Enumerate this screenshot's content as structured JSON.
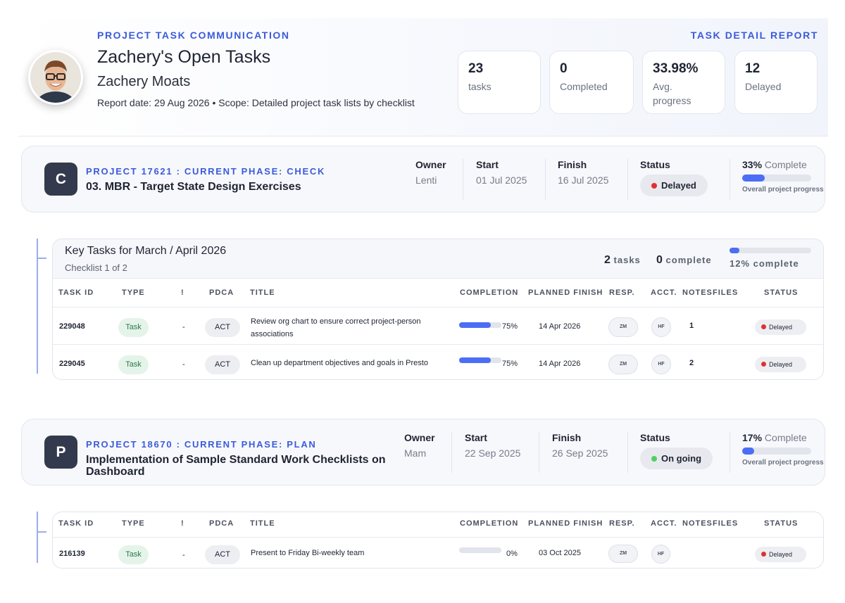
{
  "header": {
    "eyebrow": "PROJECT TASK COMMUNICATION",
    "report_type": "TASK DETAIL REPORT",
    "title": "Zachery's Open Tasks",
    "person": "Zachery Moats",
    "meta": "Report date: 29 Aug 2026  •  Scope: Detailed project task lists by checklist"
  },
  "stats": [
    {
      "value": "23",
      "label": "tasks"
    },
    {
      "value": "0",
      "label": "Completed"
    },
    {
      "value": "33.98%",
      "label": "Avg. progress"
    },
    {
      "value": "12",
      "label": "Delayed"
    }
  ],
  "projects": [
    {
      "badge": "C",
      "eyebrow": "PROJECT 17621 : CURRENT PHASE: CHECK",
      "title": "03. MBR - Target State Design Exercises",
      "owner_label": "Owner",
      "owner": "Lenti",
      "start_label": "Start",
      "start": "01 Jul 2025",
      "finish_label": "Finish",
      "finish": "16 Jul 2025",
      "status_label": "Status",
      "status": "Delayed",
      "status_color": "#e03131",
      "complete_pct": "33%",
      "complete_word": "Complete",
      "progress": 0.33,
      "progress_caption": "Overall project progress"
    },
    {
      "badge": "P",
      "eyebrow": "PROJECT 18670 : CURRENT PHASE: PLAN",
      "title": "Implementation of Sample Standard Work Checklists on Dashboard",
      "owner_label": "Owner",
      "owner": "Mam",
      "start_label": "Start",
      "start": "22 Sep 2025",
      "finish_label": "Finish",
      "finish": "26 Sep 2025",
      "status_label": "Status",
      "status": "On going",
      "status_color": "#51cf66",
      "complete_pct": "17%",
      "complete_word": "Complete",
      "progress": 0.17,
      "progress_caption": "Overall project progress"
    }
  ],
  "checklist": {
    "title": "Key Tasks for March / April 2026",
    "subtitle": "Checklist 1 of 2",
    "tasks_count": "2",
    "tasks_word": "tasks",
    "complete_count": "0",
    "complete_word": "complete",
    "progress": 0.12,
    "progress_caption": "12% complete"
  },
  "columns": [
    "TASK ID",
    "TYPE",
    "!",
    "PDCA",
    "TITLE",
    "COMPLETION",
    "PLANNED FINISH",
    "RESP.",
    "ACCT.",
    "NOTES",
    "FILES",
    "STATUS"
  ],
  "table1_rows": [
    {
      "id": "229048",
      "type": "Task",
      "flag": "-",
      "pdca": "ACT",
      "title": "Review org chart to ensure correct project-person associations",
      "completion": 0.75,
      "completion_label": "75%",
      "planned_finish": "14 Apr 2026",
      "resp": "ZM",
      "acct": "HF",
      "notes": "1",
      "files": "",
      "status": "Delayed"
    },
    {
      "id": "229045",
      "type": "Task",
      "flag": "-",
      "pdca": "ACT",
      "title": "Clean up department objectives and goals in Presto",
      "completion": 0.75,
      "completion_label": "75%",
      "planned_finish": "14 Apr 2026",
      "resp": "ZM",
      "acct": "HF",
      "notes": "2",
      "files": "",
      "status": "Delayed"
    }
  ],
  "table2_rows": [
    {
      "id": "216139",
      "type": "Task",
      "flag": "-",
      "pdca": "ACT",
      "title": "Present to Friday Bi-weekly team",
      "completion": 0,
      "completion_label": "0%",
      "planned_finish": "03 Oct 2025",
      "resp": "ZM",
      "acct": "HF",
      "notes": "",
      "files": "",
      "status": "Delayed"
    }
  ],
  "colors": {
    "accent": "#3b5bdb",
    "progress": "#4c6ef5",
    "delayed": "#e03131",
    "ongoing": "#51cf66",
    "badge": "#333a4d"
  }
}
